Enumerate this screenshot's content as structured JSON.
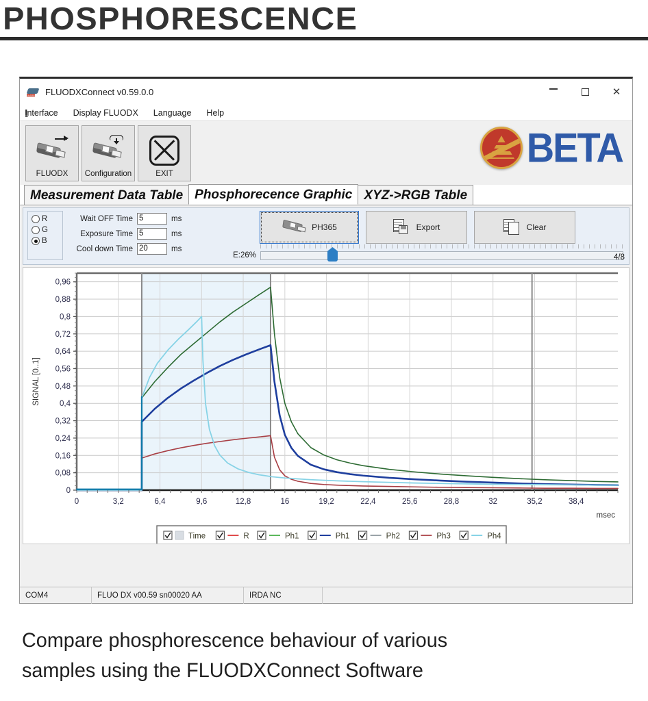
{
  "banner": {
    "title": "PHOSPHORESCENCE"
  },
  "caption": {
    "line1": "Compare phosphorescence behaviour of various",
    "line2": "samples using the FLUODXConnect Software"
  },
  "window": {
    "title": "FLUODXConnect v0.59.0.0",
    "app_icon": "fluodx-device-icon",
    "controls": {
      "minimize": "minimize-icon",
      "maximize": "maximize-icon",
      "close": "close-icon"
    }
  },
  "menubar": {
    "items": [
      {
        "label": "Interface",
        "accel": "I"
      },
      {
        "label": "Display FLUODX",
        "accel": "D"
      },
      {
        "label": "Language",
        "accel": "L"
      },
      {
        "label": "Help",
        "accel": "H"
      }
    ]
  },
  "toolbar": {
    "buttons": [
      {
        "label": "FLUODX",
        "icon": "device-with-arrow-icon"
      },
      {
        "label": "Configuration",
        "icon": "device-with-download-cloud-icon"
      },
      {
        "label": "EXIT",
        "icon": "exit-cross-icon"
      }
    ],
    "logo": {
      "text": "BETA",
      "mark": "beta-roundel-icon",
      "mark_color": "#c0392b",
      "text_color": "#2f5aa8"
    }
  },
  "tabs": [
    {
      "label": "Measurement Data Table",
      "active": false
    },
    {
      "label": "Phosphorecence Graphic",
      "active": true
    },
    {
      "label": "XYZ->RGB Table",
      "active": false
    }
  ],
  "controls": {
    "channels": [
      {
        "label": "R",
        "selected": false
      },
      {
        "label": "G",
        "selected": false
      },
      {
        "label": "B",
        "selected": true
      }
    ],
    "fields": [
      {
        "label": "Wait OFF Time",
        "value": "5",
        "unit": "ms"
      },
      {
        "label": "Exposure Time",
        "value": "5",
        "unit": "ms"
      },
      {
        "label": "Cool down Time",
        "value": "20",
        "unit": "ms"
      }
    ],
    "actions": [
      {
        "label": "PH365",
        "icon": "device-icon",
        "selected": true
      },
      {
        "label": "Export",
        "icon": "export-sheet-disk-icon",
        "selected": false
      },
      {
        "label": "Clear",
        "icon": "clear-sheet-icon",
        "selected": false
      }
    ],
    "trackbar": {
      "label": "E:26%",
      "value": 26,
      "position_fraction": 0.17
    },
    "page_counter": "4/8"
  },
  "statusbar": {
    "cells": [
      "COM4",
      "FLUO DX v00.59 sn00020 AA",
      "IRDA NC",
      ""
    ]
  },
  "chart_data": {
    "type": "line",
    "title": "",
    "xlabel": "msec",
    "ylabel": "SIGNAL [0..1]",
    "xlim": [
      0,
      41.6
    ],
    "ylim": [
      0,
      1.0
    ],
    "xticks": [
      0,
      3.2,
      6.4,
      9.6,
      12.8,
      16,
      19.2,
      22.4,
      25.6,
      28.8,
      32,
      35.2,
      38.4
    ],
    "xticklabels": [
      "0",
      "3,2",
      "6,4",
      "9,6",
      "12,8",
      "16",
      "19,2",
      "22,4",
      "25,6",
      "28,8",
      "32",
      "35,2",
      "38,4"
    ],
    "yticks": [
      0,
      0.08,
      0.16,
      0.24,
      0.32,
      0.4,
      0.48,
      0.56,
      0.64,
      0.72,
      0.8,
      0.88,
      0.96
    ],
    "yticklabels": [
      "0",
      "0,08",
      "0,16",
      "0,24",
      "0,32",
      "0,4",
      "0,48",
      "0,56",
      "0,64",
      "0,72",
      "0,8",
      "0,88",
      "0,96"
    ],
    "grid": true,
    "legend_position": "bottom",
    "cursors": {
      "excitation_start": 5.0,
      "excitation_end": 14.9,
      "marker": 35.0
    },
    "shaded_region": {
      "from": 5.0,
      "to": 14.9,
      "color": "#eaf4fb"
    },
    "legend": [
      {
        "label": "Time",
        "checked": true,
        "color": "#d8dde3",
        "swatch": "box"
      },
      {
        "label": "R",
        "checked": true,
        "color": "#e04b4b",
        "swatch": "line"
      },
      {
        "label": "Ph1",
        "checked": true,
        "color": "#5cb85c",
        "swatch": "line"
      },
      {
        "label": "Ph1",
        "checked": true,
        "color": "#1f3f9e",
        "swatch": "line"
      },
      {
        "label": "Ph2",
        "checked": true,
        "color": "#9aa3a8",
        "swatch": "line"
      },
      {
        "label": "Ph3",
        "checked": true,
        "color": "#b4555a",
        "swatch": "line"
      },
      {
        "label": "Ph4",
        "checked": true,
        "color": "#87d3e6",
        "swatch": "line"
      }
    ],
    "series": [
      {
        "name": "Ph1-green",
        "color": "#2d6b33",
        "width": 1.6,
        "points": [
          [
            0,
            0
          ],
          [
            5,
            0
          ],
          [
            5,
            0.425
          ],
          [
            6,
            0.5
          ],
          [
            7,
            0.565
          ],
          [
            8,
            0.625
          ],
          [
            9,
            0.675
          ],
          [
            10,
            0.725
          ],
          [
            11,
            0.775
          ],
          [
            12,
            0.82
          ],
          [
            13,
            0.86
          ],
          [
            14,
            0.9
          ],
          [
            14.9,
            0.935
          ],
          [
            15.2,
            0.72
          ],
          [
            15.6,
            0.52
          ],
          [
            16,
            0.4
          ],
          [
            16.5,
            0.315
          ],
          [
            17,
            0.26
          ],
          [
            18,
            0.196
          ],
          [
            19,
            0.162
          ],
          [
            20,
            0.14
          ],
          [
            21,
            0.125
          ],
          [
            22,
            0.113
          ],
          [
            24,
            0.096
          ],
          [
            26,
            0.084
          ],
          [
            28,
            0.074
          ],
          [
            30,
            0.066
          ],
          [
            32,
            0.059
          ],
          [
            34,
            0.053
          ],
          [
            36,
            0.048
          ],
          [
            38,
            0.044
          ],
          [
            40,
            0.04
          ],
          [
            41.6,
            0.038
          ]
        ]
      },
      {
        "name": "Ph1-blue",
        "color": "#1f3f9e",
        "width": 2.6,
        "points": [
          [
            0,
            0
          ],
          [
            5,
            0
          ],
          [
            5,
            0.315
          ],
          [
            6,
            0.375
          ],
          [
            7,
            0.425
          ],
          [
            8,
            0.468
          ],
          [
            9,
            0.505
          ],
          [
            10,
            0.54
          ],
          [
            11,
            0.572
          ],
          [
            12,
            0.6
          ],
          [
            13,
            0.625
          ],
          [
            14,
            0.648
          ],
          [
            14.9,
            0.668
          ],
          [
            15.2,
            0.5
          ],
          [
            15.6,
            0.345
          ],
          [
            16,
            0.255
          ],
          [
            16.5,
            0.195
          ],
          [
            17,
            0.158
          ],
          [
            18,
            0.117
          ],
          [
            19,
            0.096
          ],
          [
            20,
            0.083
          ],
          [
            21,
            0.074
          ],
          [
            22,
            0.067
          ],
          [
            24,
            0.057
          ],
          [
            26,
            0.05
          ],
          [
            28,
            0.044
          ],
          [
            30,
            0.039
          ],
          [
            32,
            0.035
          ],
          [
            34,
            0.031
          ],
          [
            36,
            0.028
          ],
          [
            38,
            0.026
          ],
          [
            40,
            0.024
          ],
          [
            41.6,
            0.023
          ]
        ]
      },
      {
        "name": "Ph3",
        "color": "#a83f45",
        "width": 1.6,
        "points": [
          [
            0,
            0
          ],
          [
            5,
            0
          ],
          [
            5,
            0.148
          ],
          [
            6,
            0.167
          ],
          [
            7,
            0.182
          ],
          [
            8,
            0.195
          ],
          [
            9,
            0.206
          ],
          [
            10,
            0.216
          ],
          [
            11,
            0.224
          ],
          [
            12,
            0.232
          ],
          [
            13,
            0.239
          ],
          [
            14,
            0.245
          ],
          [
            14.9,
            0.251
          ],
          [
            15.2,
            0.152
          ],
          [
            15.6,
            0.094
          ],
          [
            16,
            0.066
          ],
          [
            16.5,
            0.05
          ],
          [
            17,
            0.041
          ],
          [
            18,
            0.031
          ],
          [
            19,
            0.026
          ],
          [
            20,
            0.023
          ],
          [
            21,
            0.021
          ],
          [
            22,
            0.019
          ],
          [
            24,
            0.017
          ],
          [
            26,
            0.015
          ],
          [
            28,
            0.013
          ],
          [
            30,
            0.012
          ],
          [
            32,
            0.011
          ],
          [
            34,
            0.01
          ],
          [
            36,
            0.009
          ],
          [
            38,
            0.009
          ],
          [
            40,
            0.008
          ],
          [
            41.6,
            0.008
          ]
        ]
      },
      {
        "name": "Ph4",
        "color": "#87d3e6",
        "width": 1.8,
        "points": [
          [
            0,
            0
          ],
          [
            5,
            0
          ],
          [
            5,
            0.425
          ],
          [
            5.6,
            0.52
          ],
          [
            6.2,
            0.585
          ],
          [
            7,
            0.645
          ],
          [
            7.8,
            0.695
          ],
          [
            8.6,
            0.74
          ],
          [
            9.2,
            0.775
          ],
          [
            9.6,
            0.8
          ],
          [
            9.7,
            0.6
          ],
          [
            9.9,
            0.4
          ],
          [
            10.2,
            0.28
          ],
          [
            10.6,
            0.205
          ],
          [
            11,
            0.162
          ],
          [
            11.6,
            0.125
          ],
          [
            12.4,
            0.098
          ],
          [
            13.2,
            0.082
          ],
          [
            14,
            0.071
          ],
          [
            15,
            0.062
          ],
          [
            16,
            0.056
          ],
          [
            18,
            0.048
          ],
          [
            20,
            0.043
          ],
          [
            22,
            0.039
          ],
          [
            24,
            0.036
          ],
          [
            26,
            0.033
          ],
          [
            28,
            0.031
          ],
          [
            30,
            0.029
          ],
          [
            32,
            0.027
          ],
          [
            34,
            0.026
          ],
          [
            36,
            0.025
          ],
          [
            38,
            0.024
          ],
          [
            40,
            0.023
          ],
          [
            41.6,
            0.023
          ]
        ]
      },
      {
        "name": "Time",
        "color": "#0d7aa8",
        "width": 2.2,
        "points": [
          [
            0,
            0.004
          ],
          [
            5,
            0.004
          ],
          [
            5,
            0.43
          ]
        ]
      }
    ]
  }
}
